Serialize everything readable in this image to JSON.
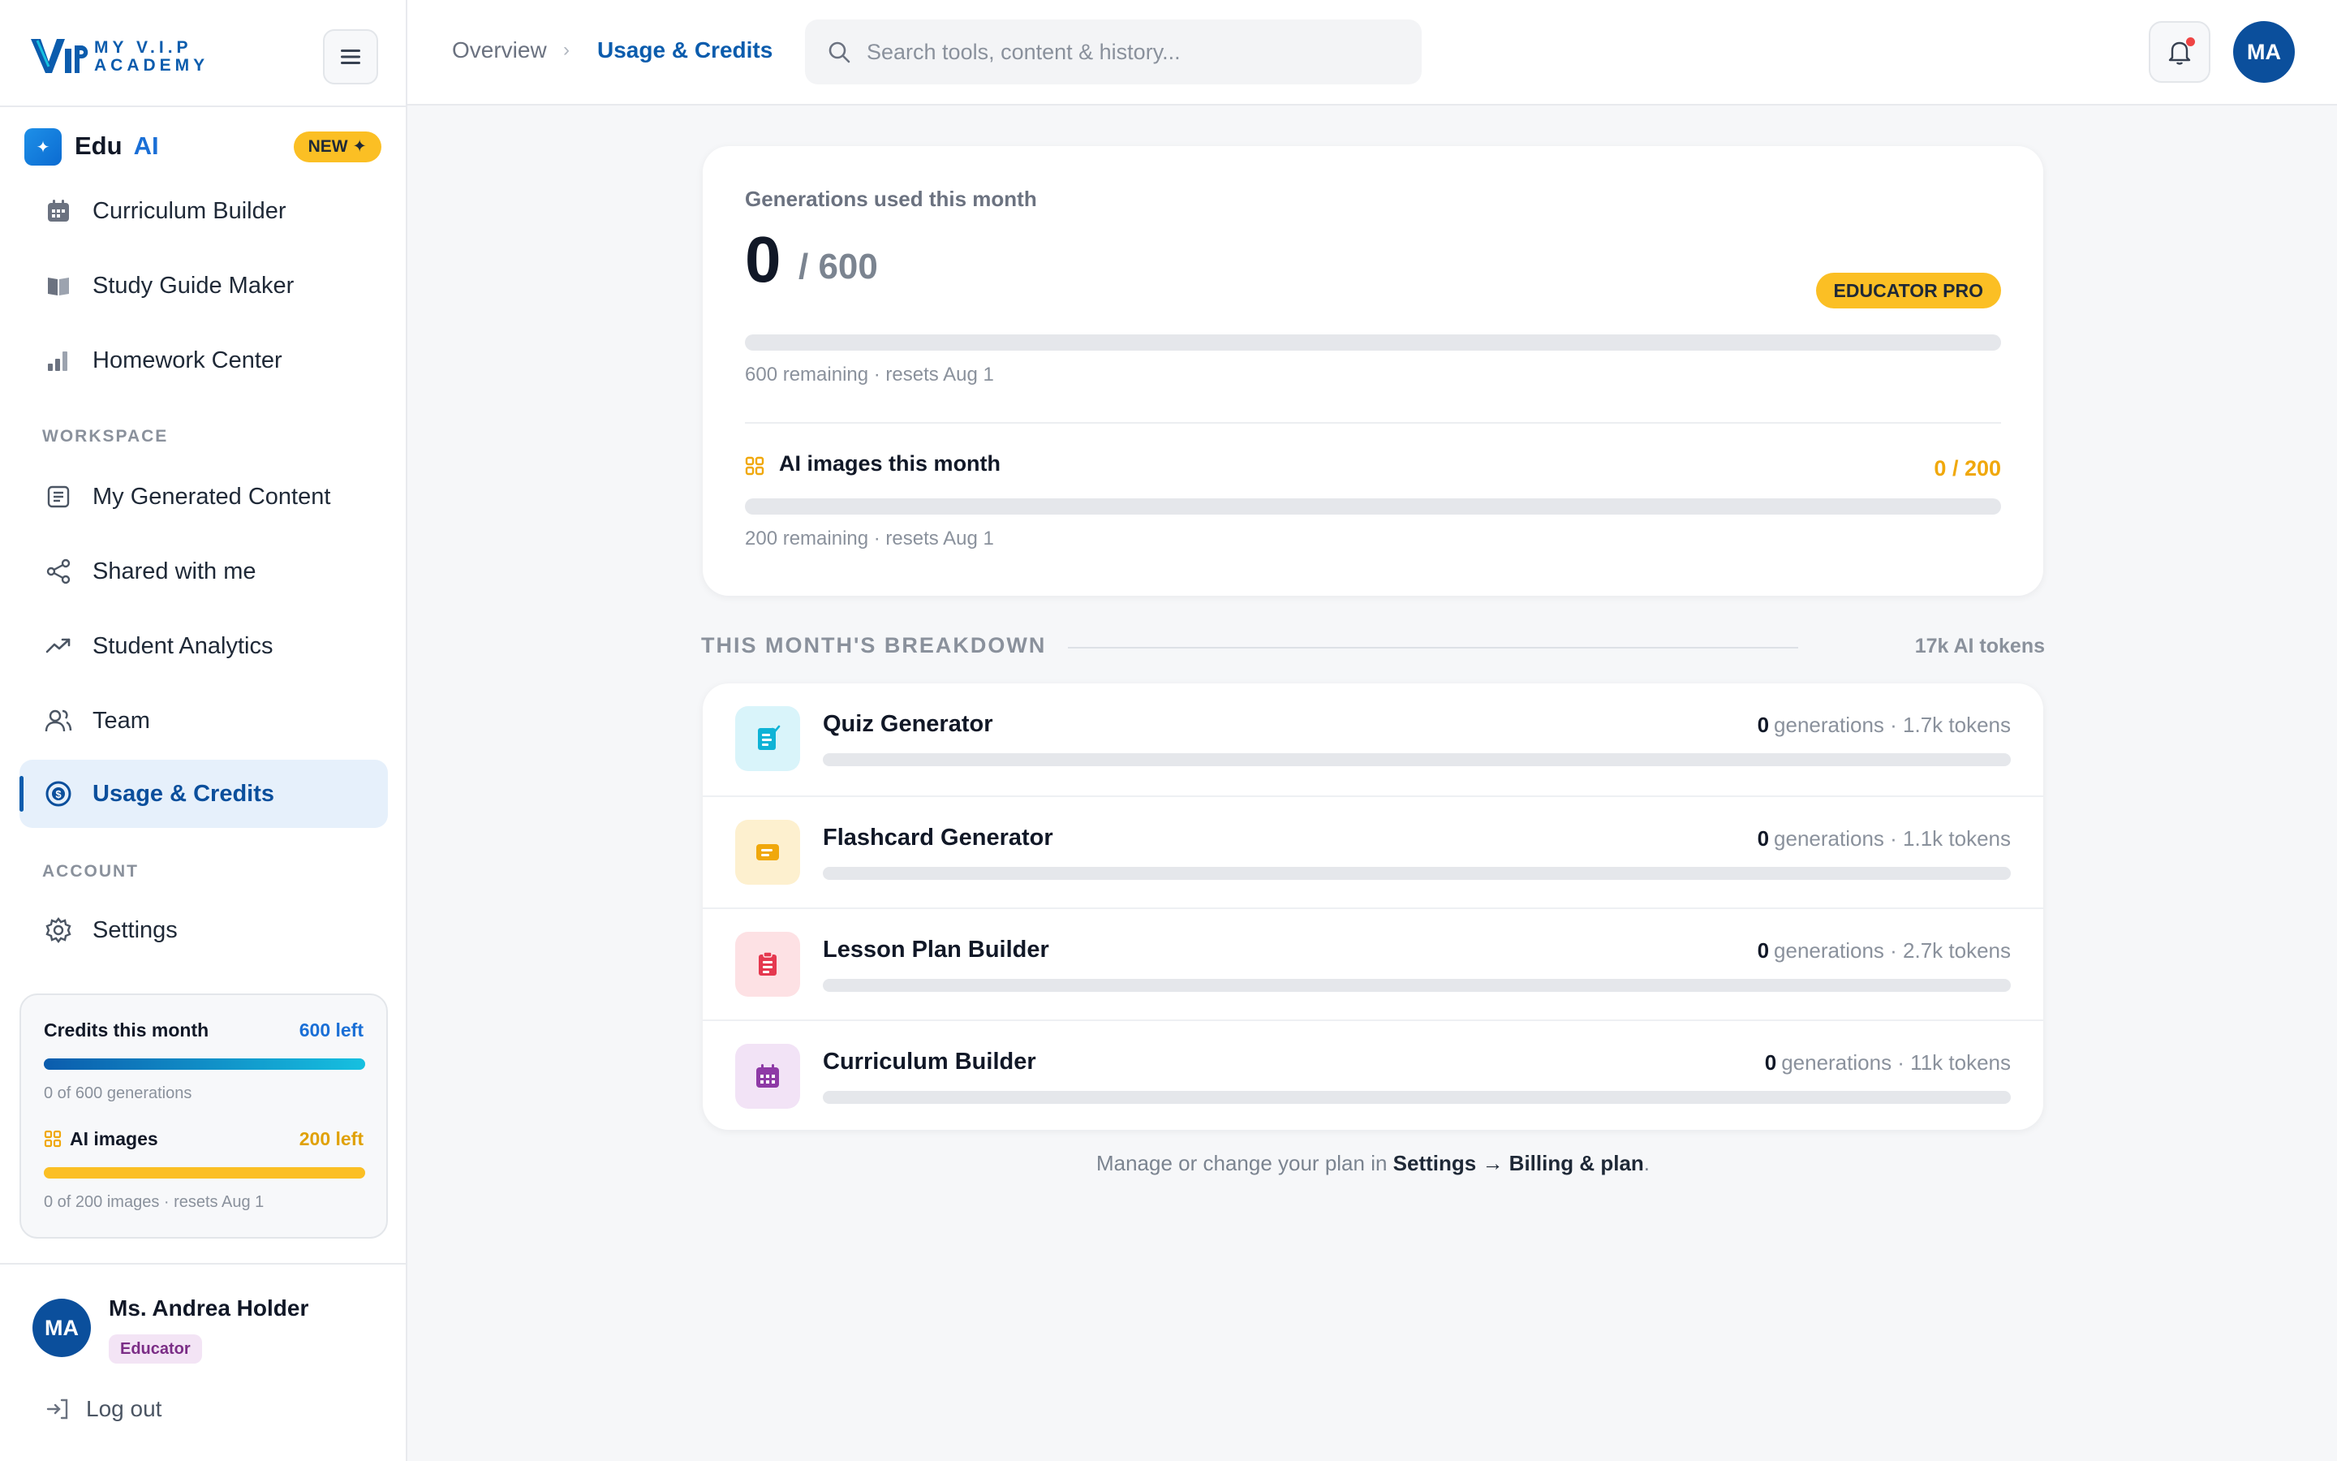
{
  "brand": {
    "logo_text_line1": "MY V.I.P",
    "logo_text_line2": "ACADEMY"
  },
  "edu_ai": {
    "name": "Edu",
    "name_accent": "AI",
    "badge": "NEW ✦"
  },
  "sidebar": {
    "tools": [
      {
        "label": "Curriculum Builder",
        "icon": "calendar-icon"
      },
      {
        "label": "Study Guide Maker",
        "icon": "book-icon"
      },
      {
        "label": "Homework Center",
        "icon": "bar-chart-icon"
      }
    ],
    "workspace_label": "WORKSPACE",
    "workspace": [
      {
        "label": "My Generated Content",
        "icon": "document-icon"
      },
      {
        "label": "Shared with me",
        "icon": "share-icon"
      },
      {
        "label": "Student Analytics",
        "icon": "trend-icon"
      },
      {
        "label": "Team",
        "icon": "users-icon"
      },
      {
        "label": "Usage & Credits",
        "icon": "credits-icon",
        "active": true
      }
    ],
    "account_label": "ACCOUNT",
    "account": [
      {
        "label": "Settings",
        "icon": "gear-icon"
      }
    ],
    "credits": {
      "title": "Credits this month",
      "left": "600 left",
      "sub": "0 of 600 generations",
      "images_title": "AI images",
      "images_left": "200 left",
      "images_sub": "0 of 200 images · resets Aug 1",
      "generations_remaining_fraction": 1.0,
      "images_remaining_fraction": 1.0
    },
    "user": {
      "initials": "MA",
      "name": "Ms. Andrea Holder",
      "role": "Educator",
      "logout": "Log out"
    }
  },
  "topbar": {
    "breadcrumb": [
      "Overview",
      "Usage & Credits"
    ],
    "search_placeholder": "Search tools, content & history...",
    "avatar_initials": "MA"
  },
  "summary": {
    "label": "Generations used this month",
    "used": "0",
    "total": "/ 600",
    "plan": "EDUCATOR PRO",
    "used_fraction": 0,
    "sub": "600 remaining · resets Aug 1",
    "images_title": "AI images this month",
    "images_count": "0 / 200",
    "images_used_fraction": 0,
    "images_sub": "200 remaining · resets Aug 1"
  },
  "breakdown": {
    "title": "THIS MONTH'S BREAKDOWN",
    "tokens": "17k AI tokens",
    "items": [
      {
        "name": "Quiz Generator",
        "count": "0",
        "stats": "generations · 1.7k tokens",
        "icon": "quiz-icon",
        "color": "#0fb3d6",
        "bg": "#d9f4fa",
        "used_fraction": 0
      },
      {
        "name": "Flashcard Generator",
        "count": "0",
        "stats": "generations · 1.1k tokens",
        "icon": "flashcard-icon",
        "color": "#f0a80c",
        "bg": "#fdf0cf",
        "used_fraction": 0
      },
      {
        "name": "Lesson Plan Builder",
        "count": "0",
        "stats": "generations · 2.7k tokens",
        "icon": "lesson-plan-icon",
        "color": "#e5384f",
        "bg": "#fde1e4",
        "used_fraction": 0
      },
      {
        "name": "Curriculum Builder",
        "count": "0",
        "stats": "generations · 11k tokens",
        "icon": "curriculum-icon",
        "color": "#8e3aa6",
        "bg": "#f2e3f6",
        "used_fraction": 0
      }
    ]
  },
  "footer": {
    "prefix": "Manage or change your plan in",
    "link": "Settings → Billing & plan",
    "suffix": "."
  },
  "colors": {
    "brand_blue": "#0b5cad",
    "accent_yellow": "#fbbf24",
    "credits_gradient_start": "#0b5cad",
    "credits_gradient_end": "#16c0e0"
  }
}
